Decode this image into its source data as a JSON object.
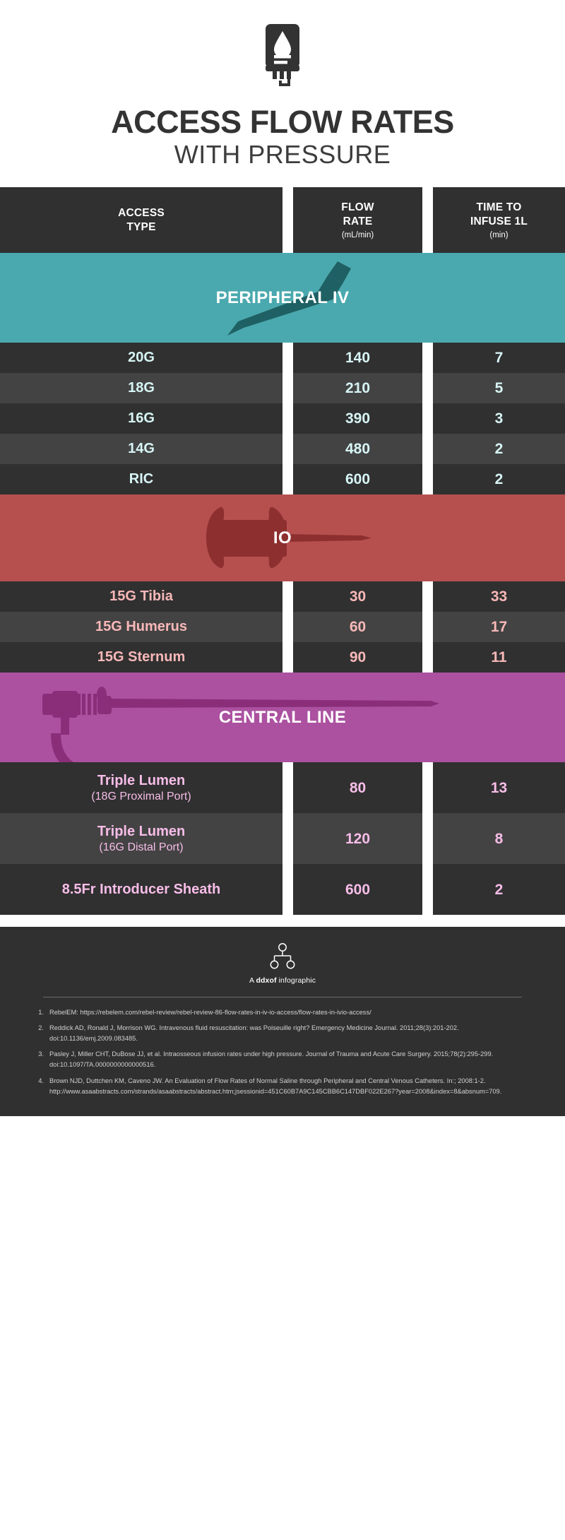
{
  "header": {
    "icon": "iv-bag-icon",
    "title": "ACCESS FLOW RATES",
    "subtitle": "WITH PRESSURE"
  },
  "columns": {
    "access_type": {
      "line1": "ACCESS",
      "line2": "TYPE"
    },
    "flow_rate": {
      "line1": "FLOW",
      "line2": "RATE",
      "unit": "(mL/min)"
    },
    "time_to_infuse": {
      "line1": "TIME TO",
      "line2": "INFUSE 1L",
      "unit": "(min)"
    }
  },
  "colors": {
    "peripheral_iv": "#4aa9ae",
    "io": "#b6504f",
    "central_line": "#ab51a0",
    "row_dark": "#303030",
    "row_light": "#434343",
    "text_piv": "#d7f4f5",
    "text_io": "#f9b8b8",
    "text_cl": "#f7bde8"
  },
  "sections": [
    {
      "id": "peripheral-iv",
      "label": "PERIPHERAL IV",
      "icon": "iv-catheter-needle-icon",
      "rows": [
        {
          "name": "20G",
          "sub": "",
          "flow": "140",
          "time": "7"
        },
        {
          "name": "18G",
          "sub": "",
          "flow": "210",
          "time": "5"
        },
        {
          "name": "16G",
          "sub": "",
          "flow": "390",
          "time": "3"
        },
        {
          "name": "14G",
          "sub": "",
          "flow": "480",
          "time": "2"
        },
        {
          "name": "RIC",
          "sub": "",
          "flow": "600",
          "time": "2"
        }
      ]
    },
    {
      "id": "io",
      "label": "IO",
      "icon": "io-needle-icon",
      "rows": [
        {
          "name": "15G Tibia",
          "sub": "",
          "flow": "30",
          "time": "33"
        },
        {
          "name": "15G Humerus",
          "sub": "",
          "flow": "60",
          "time": "17"
        },
        {
          "name": "15G Sternum",
          "sub": "",
          "flow": "90",
          "time": "11"
        }
      ]
    },
    {
      "id": "central-line",
      "label": "CENTRAL LINE",
      "icon": "central-line-catheter-icon",
      "rows": [
        {
          "name": "Triple Lumen",
          "sub": "(18G Proximal Port)",
          "flow": "80",
          "time": "13"
        },
        {
          "name": "Triple Lumen",
          "sub": "(16G Distal Port)",
          "flow": "120",
          "time": "8"
        },
        {
          "name": "8.5Fr Introducer Sheath",
          "sub": "",
          "flow": "600",
          "time": "2"
        }
      ]
    }
  ],
  "footer": {
    "logo_icon": "ddxof-tree-logo-icon",
    "brand_prefix": "A ",
    "brand_name": "ddxof",
    "brand_suffix": " infographic",
    "references": [
      {
        "num": "1.",
        "text": "RebelEM: https://rebelem.com/rebel-review/rebel-review-86-flow-rates-in-iv-io-access/flow-rates-in-ivio-access/"
      },
      {
        "num": "2.",
        "text": "Reddick AD, Ronald J, Morrison WG. Intravenous fluid resuscitation: was Poiseuille right? Emergency Medicine Journal. 2011;28(3):201-202. doi:10.1136/emj.2009.083485."
      },
      {
        "num": "3.",
        "text": "Pasley J, Miller CHT, DuBose JJ, et al. Intraosseous infusion rates under high pressure. Journal of Trauma and Acute Care Surgery. 2015;78(2):295-299. doi:10.1097/TA.0000000000000516."
      },
      {
        "num": "4.",
        "text": "Brown NJD, Duttchen KM, Caveno JW. An Evaluation of Flow Rates of Normal Saline through Peripheral and Central Venous Catheters. In:; 2008:1-2. http://www.asaabstracts.com/strands/asaabstracts/abstract.htm;jsessionid=451C60B7A9C145CBB6C147DBF022E267?year=2008&index=8&absnum=709."
      }
    ]
  }
}
